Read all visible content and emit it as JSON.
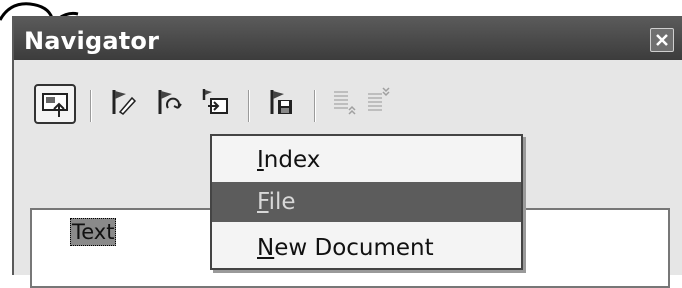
{
  "window": {
    "title": "Navigator",
    "close_icon": "close-icon"
  },
  "toolbar": {
    "buttons": [
      {
        "name": "drag-mode-icon",
        "pressed": true
      },
      {
        "name": "edit-flag-icon"
      },
      {
        "name": "next-flag-icon"
      },
      {
        "name": "insert-flag-icon"
      },
      {
        "name": "save-flag-icon"
      },
      {
        "name": "promote-level-icon",
        "disabled": true
      },
      {
        "name": "demote-level-icon",
        "disabled": true
      }
    ]
  },
  "drag_menu": {
    "items": [
      {
        "label": "Index",
        "mnemonic": "I",
        "rest": "ndex",
        "selected": false
      },
      {
        "label": "File",
        "mnemonic": "F",
        "rest": "ile",
        "selected": true
      },
      {
        "label": "New Document",
        "mnemonic": "N",
        "rest": "ew Document",
        "selected": false
      }
    ]
  },
  "content_list": {
    "entries": [
      "Text"
    ]
  },
  "colors": {
    "titlebar": "#4a4a4a",
    "selection": "#5c5c5c",
    "window_bg": "#e6e6e6"
  }
}
